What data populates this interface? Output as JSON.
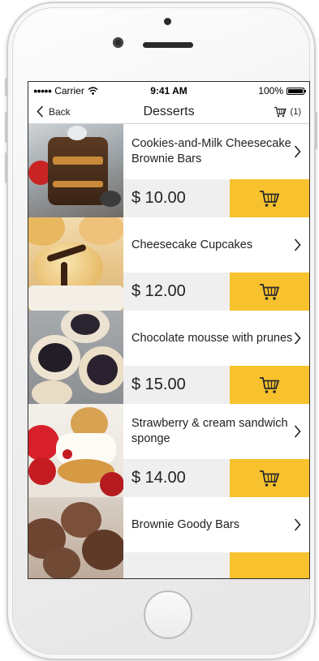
{
  "status_bar": {
    "carrier": "Carrier",
    "time": "9:41 AM",
    "battery": "100%"
  },
  "nav": {
    "back_label": "Back",
    "title": "Desserts",
    "cart_count": "(1)"
  },
  "items": [
    {
      "name": "Cookies-and-Milk Cheesecake Brownie Bars",
      "price": "$ 10.00"
    },
    {
      "name": "Cheesecake Cupcakes",
      "price": "$ 12.00"
    },
    {
      "name": "Chocolate mousse with prunes",
      "price": "$ 15.00"
    },
    {
      "name": "Strawberry & cream sandwich sponge",
      "price": "$ 14.00"
    },
    {
      "name": "Brownie Goody Bars",
      "price": ""
    }
  ],
  "colors": {
    "accent": "#f7c22d",
    "price_bg": "#efefef"
  }
}
